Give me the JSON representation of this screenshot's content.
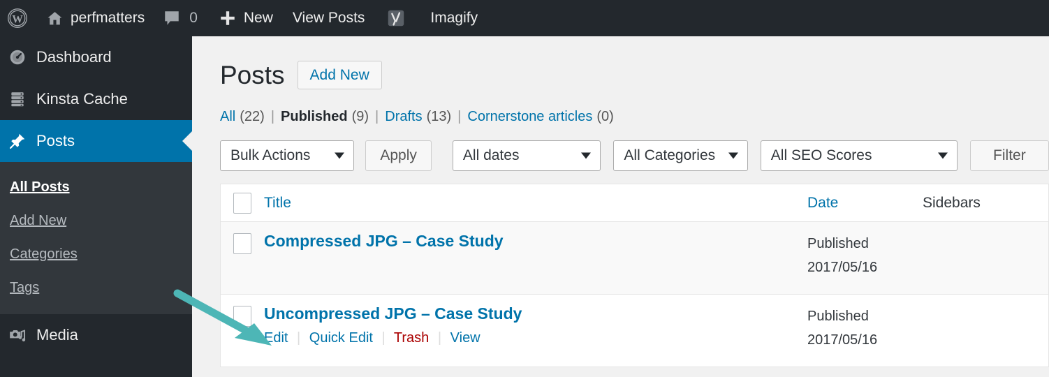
{
  "colors": {
    "adminbar_bg": "#23282d",
    "sidebar_bg": "#23282d",
    "submenu_bg": "#32373c",
    "accent_blue": "#0073aa",
    "link_blue": "#0073aa",
    "trash_red": "#a00000",
    "annotation_teal": "#4db6b6",
    "content_bg": "#f1f1f1"
  },
  "adminbar": {
    "wp_logo_icon": "wordpress-logo-icon",
    "site_home_icon": "home-icon",
    "site_name": "perfmatters",
    "comments_icon": "comment-bubble-icon",
    "comments_count": "0",
    "new_icon": "plus-icon",
    "new_label": "New",
    "view_posts_label": "View Posts",
    "yoast_icon": "yoast-seo-icon",
    "imagify_label": "Imagify"
  },
  "sidebar": {
    "items": [
      {
        "label": "Dashboard",
        "icon": "dashboard-gauge-icon",
        "current": false
      },
      {
        "label": "Kinsta Cache",
        "icon": "server-stack-icon",
        "current": false
      },
      {
        "label": "Posts",
        "icon": "pin-icon",
        "current": true
      },
      {
        "label": "Media",
        "icon": "camera-music-icon",
        "current": false
      }
    ],
    "submenu": [
      {
        "label": "All Posts",
        "current": true
      },
      {
        "label": "Add New",
        "current": false
      },
      {
        "label": "Categories",
        "current": false
      },
      {
        "label": "Tags",
        "current": false
      }
    ]
  },
  "main": {
    "page_title": "Posts",
    "add_new_label": "Add New",
    "status_links": [
      {
        "label": "All",
        "count": "(22)",
        "current": false
      },
      {
        "label": "Published",
        "count": "(9)",
        "current": true
      },
      {
        "label": "Drafts",
        "count": "(13)",
        "current": false
      },
      {
        "label": "Cornerstone articles",
        "count": "(0)",
        "current": false
      }
    ],
    "toolbar": {
      "bulk_actions_value": "Bulk Actions",
      "apply_label": "Apply",
      "dates_value": "All dates",
      "categories_value": "All Categories",
      "seo_scores_value": "All SEO Scores",
      "filter_label": "Filter"
    },
    "table": {
      "columns": [
        {
          "label": "Title",
          "link": true
        },
        {
          "label": "Date",
          "link": true
        },
        {
          "label": "Sidebars",
          "link": false
        }
      ],
      "rows": [
        {
          "title": "Compressed JPG – Case Study",
          "status": "Published",
          "date": "2017/05/16",
          "sidebars": "",
          "actions": []
        },
        {
          "title": "Uncompressed JPG – Case Study",
          "status": "Published",
          "date": "2017/05/16",
          "sidebars": "",
          "actions": [
            {
              "label": "Edit",
              "kind": "edit"
            },
            {
              "label": "Quick Edit",
              "kind": "quick-edit"
            },
            {
              "label": "Trash",
              "kind": "trash"
            },
            {
              "label": "View",
              "kind": "view"
            }
          ]
        }
      ]
    }
  }
}
